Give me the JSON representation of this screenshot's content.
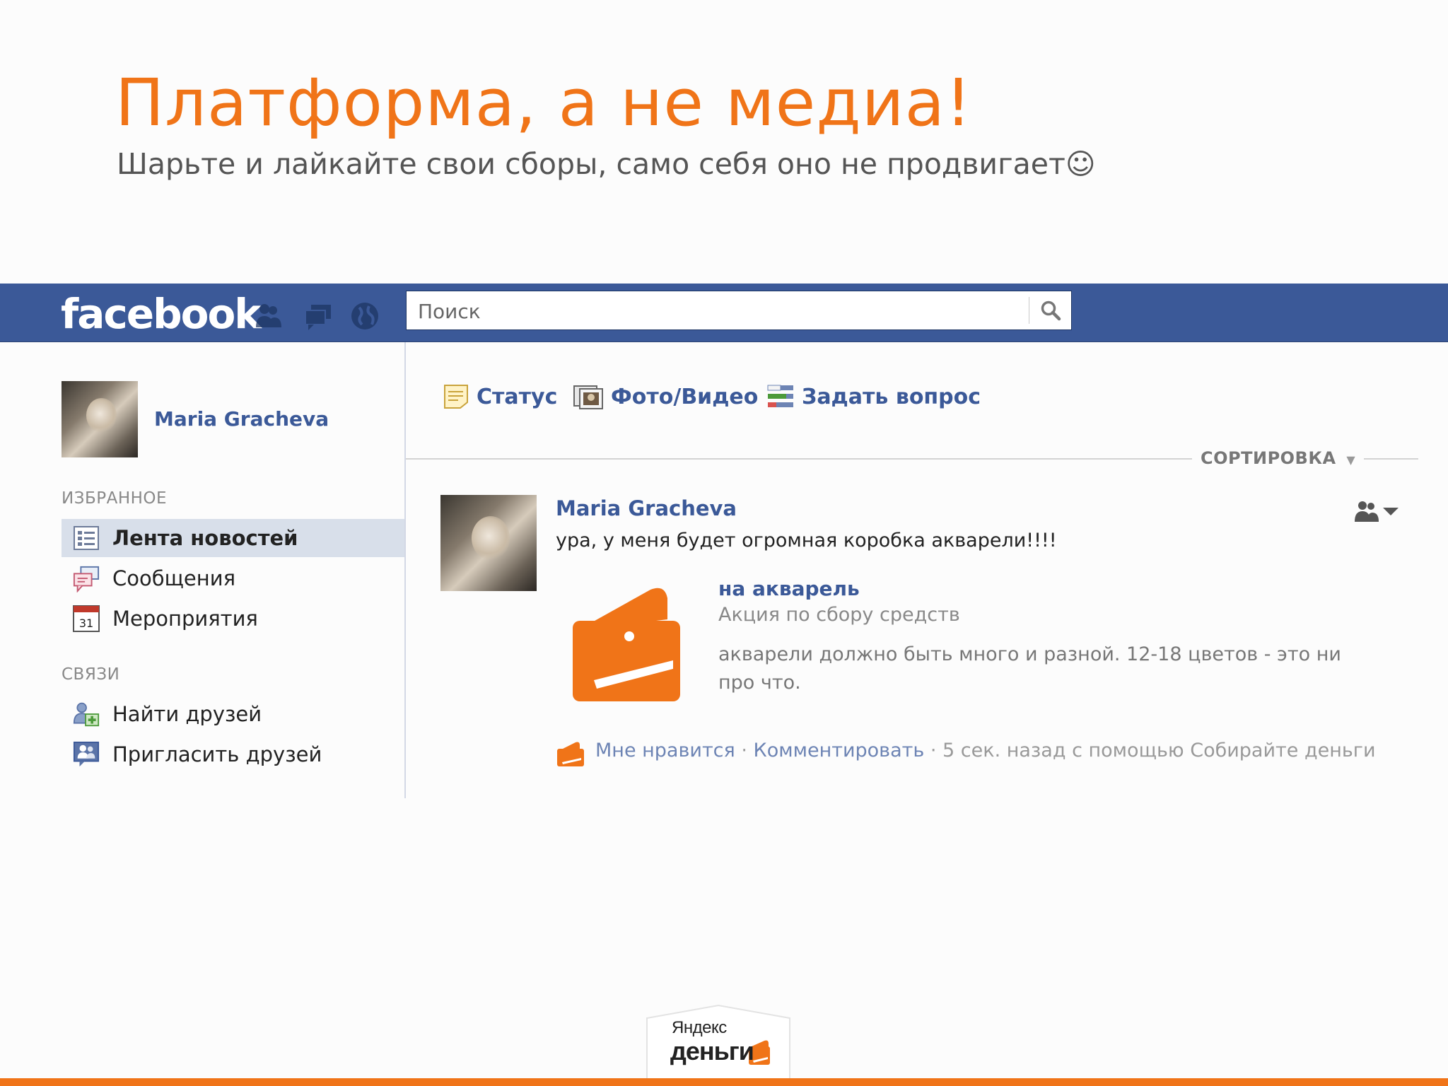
{
  "slide": {
    "title": "Платформа, а не медиа!",
    "subtitle": "Шарьте и лайкайте свои сборы, само себя оно не продвигает☺"
  },
  "topbar": {
    "logo": "facebook",
    "search_placeholder": "Поиск",
    "icons": [
      "friends-icon",
      "messages-icon",
      "notifications-globe-icon",
      "search-icon"
    ]
  },
  "sidebar": {
    "profile_name": "Maria Gracheva",
    "favorites_header": "ИЗБРАННОЕ",
    "favorites": [
      {
        "label": "Лента новостей",
        "icon": "news-feed-icon",
        "active": true
      },
      {
        "label": "Сообщения",
        "icon": "messages-icon"
      },
      {
        "label": "Мероприятия",
        "icon": "events-calendar-icon",
        "calendar_day": "31"
      }
    ],
    "connections_header": "СВЯЗИ",
    "connections": [
      {
        "label": "Найти друзей",
        "icon": "find-friends-icon"
      },
      {
        "label": "Пригласить друзей",
        "icon": "invite-friends-icon"
      }
    ]
  },
  "composer": {
    "status": "Статус",
    "photo_video": "Фото/Видео",
    "question": "Задать вопрос"
  },
  "feed": {
    "sort_label": "СОРТИРОВКА",
    "post": {
      "author": "Maria Gracheva",
      "text": "ура, у меня будет огромная коробка акварели!!!!",
      "attachment": {
        "title": "на акварель",
        "caption": "Акция по сбору средств",
        "description": "акварели должно быть много и разной. 12-18 цветов - это ни про что."
      },
      "footer": {
        "like": "Мне нравится",
        "sep": "·",
        "comment": "Комментировать",
        "meta": "· 5 сек. назад с помощью Собирайте деньги"
      }
    }
  },
  "branding": {
    "line1": "Яндекс",
    "line2": "деньги"
  },
  "colors": {
    "accent": "#f07418",
    "fb_blue": "#3b5998",
    "link": "#3b5998"
  }
}
